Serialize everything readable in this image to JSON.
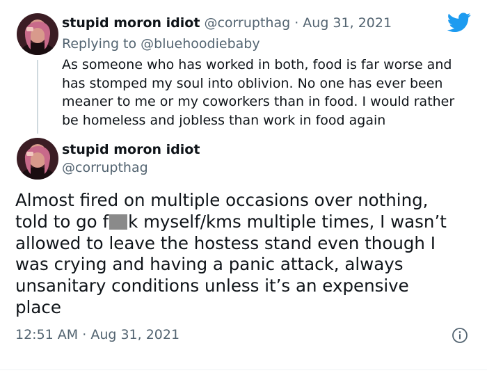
{
  "tweet1": {
    "display_name": "stupid moron idiot",
    "handle": "@corrupthag",
    "separator": "·",
    "date": "Aug 31, 2021",
    "replying_prefix": "Replying to",
    "replying_to": "@bluehoodiebaby",
    "body_lines": [
      "As someone who has worked in both, food is far worse and",
      "has stomped my soul into oblivion. No one has ever been",
      "meaner to me or my coworkers than in food. I would rather",
      "be homeless and jobless than work in food again"
    ]
  },
  "tweet2": {
    "display_name": "stupid moron idiot",
    "handle": "@corrupthag",
    "body_line1_before": "Almost fired on multiple occasions over nothing,",
    "body_line2_before": "told to go f",
    "body_line2_after": "k myself/kms multiple times, I wasn’t",
    "body_lines_rest": [
      "allowed to leave the hostess stand even though I",
      "was crying and having a panic attack, always",
      "unsanitary conditions unless it’s an expensive",
      "place"
    ],
    "time": "12:51 AM",
    "separator": "·",
    "date": "Aug 31, 2021"
  },
  "icons": {
    "brand": "twitter-bird-icon",
    "info": "info-icon"
  },
  "colors": {
    "brand_blue": "#1d9bf0",
    "muted_text": "#536471",
    "thread_line": "#cfd9de"
  }
}
